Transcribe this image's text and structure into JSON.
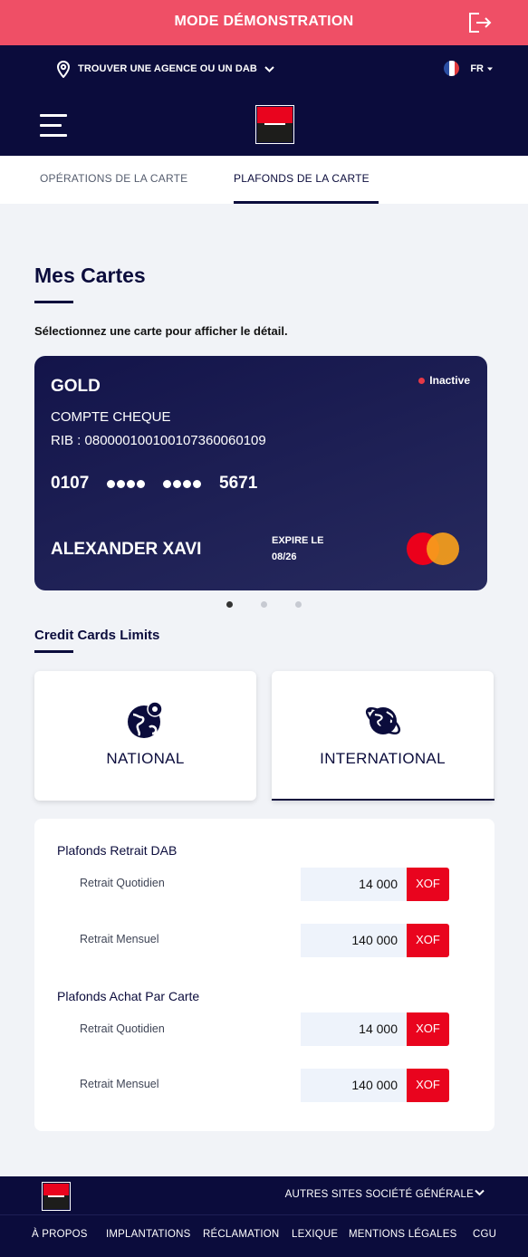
{
  "demo_bar": {
    "title": "MODE DÉMONSTRATION",
    "color": "#ef4f66"
  },
  "topnav": {
    "locator_label": "TROUVER UNE AGENCE OU UN DAB",
    "language": "FR"
  },
  "tabs": [
    {
      "label": "OPÉRATIONS DE LA CARTE",
      "active": false
    },
    {
      "label": "PLAFONDS DE LA CARTE",
      "active": true
    }
  ],
  "cards_section": {
    "title": "Mes Cartes",
    "subtitle": "Sélectionnez une carte pour afficher le détail."
  },
  "card": {
    "type": "GOLD",
    "status": "Inactive",
    "account": "COMPTE CHEQUE",
    "rib": "RIB : 08000010010010736006010​9",
    "number_first": "0107",
    "number_last": "5671",
    "holder": "ALEXANDER XAVI",
    "expire_label": "EXPIRE LE",
    "expire_value": "08/26",
    "network_icon": "mastercard-icon"
  },
  "carousel": {
    "count": 3,
    "active_index": 0
  },
  "limits_section": {
    "title": "Credit Cards Limits"
  },
  "scopes": [
    {
      "label": "NATIONAL",
      "icon": "globe-pin-icon",
      "active": false
    },
    {
      "label": "INTERNATIONAL",
      "icon": "globe-orbit-icon",
      "active": true
    }
  ],
  "limit_groups": [
    {
      "title": "Plafonds Retrait DAB",
      "rows": [
        {
          "label": "Retrait Quotidien",
          "amount": "14 000",
          "currency": "XOF"
        },
        {
          "label": "Retrait Mensuel",
          "amount": "140 000",
          "currency": "XOF"
        }
      ]
    },
    {
      "title": "Plafonds Achat Par Carte",
      "rows": [
        {
          "label": "Retrait Quotidien",
          "amount": "14 000",
          "currency": "XOF"
        },
        {
          "label": "Retrait Mensuel",
          "amount": "140 000",
          "currency": "XOF"
        }
      ]
    }
  ],
  "footer": {
    "other_sites": "AUTRES SITES SOCIÉTÉ GÉNÉRALE",
    "links": [
      "À PROPOS",
      "IMPLANTATIONS",
      "RÉCLAMATION",
      "LEXIQUE",
      "MENTIONS LÉGALES",
      "CGU"
    ]
  },
  "colors": {
    "navy": "#0b0c3c",
    "brand_red": "#e9041e",
    "background": "#f1f3f7"
  }
}
